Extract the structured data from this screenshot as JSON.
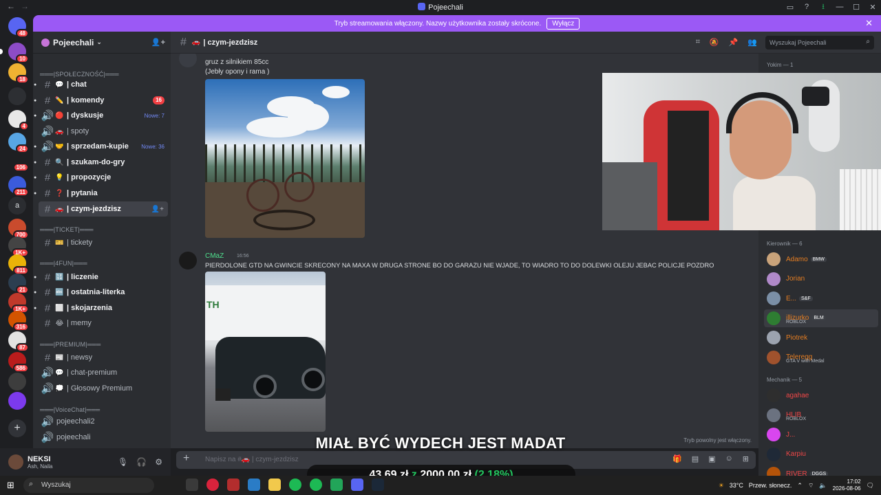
{
  "window": {
    "title": "Pojeechali"
  },
  "banner": {
    "text": "Tryb streamowania włączony. Nazwy użytkownika zostały skrócone.",
    "button": "Wyłącz"
  },
  "guilds": {
    "badges": [
      "48",
      "10",
      "18",
      "4",
      "24",
      "106",
      "211",
      "700",
      "1K+",
      "811",
      "21",
      "1K+",
      "316",
      "87",
      "586"
    ],
    "letter": "a"
  },
  "server": {
    "name": "Pojeechali"
  },
  "categories": {
    "community": "═══|SPOŁECZNOŚĆ|═══",
    "ticket": "═══|TICKET|═══",
    "fun": "═══|4FUN|═══",
    "premium": "═══|PREMIUM|═══",
    "voice": "═══|VoiceChat|═══"
  },
  "channels": [
    {
      "emoji": "💬",
      "name": "| chat"
    },
    {
      "emoji": "✏️",
      "name": "| komendy",
      "badge": "16"
    },
    {
      "emoji": "🔴",
      "name": "| dyskusje",
      "nowe": "Nowe: 7"
    },
    {
      "emoji": "🚗",
      "name": "| spoty"
    },
    {
      "emoji": "🤝",
      "name": "| sprzedam-kupie",
      "nowe": "Nowe: 36"
    },
    {
      "emoji": "🔍",
      "name": "| szukam-do-gry"
    },
    {
      "emoji": "💡",
      "name": "| propozycje"
    },
    {
      "emoji": "❓",
      "name": "| pytania"
    },
    {
      "emoji": "🚗",
      "name": "| czym-jezdzisz"
    },
    {
      "emoji": "🎫",
      "name": "| tickety"
    },
    {
      "emoji": "🔢",
      "name": "| liczenie"
    },
    {
      "emoji": "🔤",
      "name": "| ostatnia-literka"
    },
    {
      "emoji": "⬜",
      "name": "| skojarzenia"
    },
    {
      "emoji": "😂",
      "name": "| memy"
    },
    {
      "emoji": "📰",
      "name": "| newsy"
    },
    {
      "emoji": "💬",
      "name": "| chat-premium"
    },
    {
      "emoji": "💭",
      "name": "| Głosowy Premium"
    },
    {
      "emoji": "",
      "name": "pojeechali2"
    },
    {
      "emoji": "",
      "name": "pojeechali"
    }
  ],
  "user": {
    "name": "NEKSI",
    "status": "Ash, Naila"
  },
  "chat": {
    "channel": "| czym-jezdzisz",
    "channel_emoji": "🚗",
    "search_placeholder": "Wyszukaj Pojeechali",
    "composer_placeholder": "Napisz na #🚗 | czym-jezdzisz",
    "slowmode": "Tryb powolny jest włączony."
  },
  "messages": [
    {
      "lines": [
        "gruz z silnikiem 85cc",
        "(Jebły opony i rama )"
      ]
    },
    {
      "author": "CMaZ",
      "time": "16:56",
      "text": "PIERDOLONE GTD NA GWINCIE SKRECONY NA MAXA W DRUGA STRONE BO DO GARAZU NIE WJADE, TO WIADRO TO DO DOLEWKI OLEJU JEBAC POLICJE POZDRO"
    }
  ],
  "overlay": {
    "caption": "MIAŁ BYĆ WYDECH JEST MADAT",
    "donation_current": "43,69 zł",
    "donation_sep": "z",
    "donation_goal": "2000,00 zł",
    "donation_pct": "(2.18%)"
  },
  "members": {
    "groups": [
      {
        "title": "Yokim — 1"
      },
      {
        "title": "Kierownik — 6"
      },
      {
        "title": "Mechanik — 5"
      }
    ],
    "kierownik": [
      {
        "name": "Adamo",
        "tag": "BMW",
        "color": "#e67e22"
      },
      {
        "name": "Jorian",
        "color": "#e67e22"
      },
      {
        "name": "E...",
        "tag": "S&F",
        "color": "#e67e22"
      },
      {
        "name": "illizurko",
        "tag": "BLM",
        "sub": "ROBLOX",
        "color": "#e67e22"
      },
      {
        "name": "Piotrek",
        "color": "#e67e22"
      },
      {
        "name": "Teleregg",
        "sub": "GTA V with Medal",
        "color": "#e67e22"
      }
    ],
    "mechanik": [
      {
        "name": "agahae",
        "color": "#f04747"
      },
      {
        "name": "HLIB",
        "sub": "ROBLOX",
        "color": "#f04747"
      },
      {
        "name": "J...",
        "color": "#f04747"
      },
      {
        "name": "Karpiu",
        "color": "#f04747"
      },
      {
        "name": "RIVER",
        "tag": "DGGS",
        "color": "#f04747"
      }
    ]
  },
  "taskbar": {
    "search": "Wyszukaj",
    "weather": "33°C",
    "weather_text": "Przew. słonecz.",
    "time": "17:02",
    "date": "2026-08-06"
  }
}
